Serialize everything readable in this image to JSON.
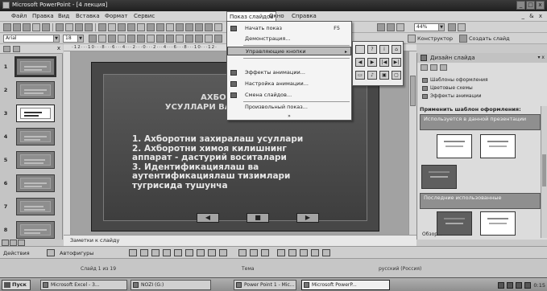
{
  "window": {
    "title": "Microsoft PowerPoint - [4 лекция]",
    "controls": [
      "_",
      "□",
      "x"
    ]
  },
  "menubar": {
    "items": [
      "Файл",
      "Правка",
      "Вид",
      "Вставка",
      "Формат",
      "Сервис",
      "Показ слайдов",
      "Окно",
      "Справка"
    ],
    "doc_controls": "_ & x"
  },
  "toolbar": {
    "font": "Arial",
    "size": "18",
    "zoom": "44%",
    "constructor": "Конструктор",
    "new_slide": "Создать слайд"
  },
  "menu": {
    "items": [
      {
        "label": "Начать показ",
        "shortcut": "F5"
      },
      {
        "label": "Демонстрация..."
      },
      {
        "label": "Управляющие кнопки",
        "submenu": "▸"
      },
      {
        "label": "Эффекты анимации..."
      },
      {
        "label": "Настройка анимации..."
      },
      {
        "label": "Смена слайдов..."
      },
      {
        "label": "Произвольный показ..."
      }
    ],
    "more": "»"
  },
  "action_buttons": [
    "",
    "?",
    "i",
    "⌂",
    "◀",
    "▶",
    "|◀",
    "▶|",
    "▭",
    "♪",
    "▣",
    "▢"
  ],
  "slides": {
    "numbers": [
      "1",
      "2",
      "3",
      "4",
      "5",
      "6",
      "7",
      "8"
    ]
  },
  "slide": {
    "title_line1": "АХБОРОТНИ ...",
    "title_line2": "УСУЛЛАРИ ВА ... МОДЕЛЛАРИ",
    "bullets": [
      "1. Ахборотни захиралаш усуллари",
      "2. Ахборотни химоя килишнинг",
      "аппарат - дастурий воситалари",
      "3. Идентификациялаш ва",
      "аутентификациялаш тизимлари",
      "тугрисида тушунча"
    ],
    "nav": [
      "◀",
      "■",
      "▶"
    ]
  },
  "taskpane": {
    "title": "Дизайн слайда",
    "controls": "▾ x",
    "links": [
      "Шаблоны оформления",
      "Цветовые схемы",
      "Эффекты анимации"
    ],
    "apply_label": "Применить шаблон оформления:",
    "section_used": "Используется в данной презентации",
    "section_recent": "Последние использованные",
    "browse": "Обзор..."
  },
  "notes": {
    "placeholder": "Заметки к слайду"
  },
  "drawbar": {
    "actions": "Действия",
    "autoshapes": "Автофигуры"
  },
  "status": {
    "slide": "Слайд 1 из 19",
    "design": "Тема",
    "language": "русский (Россия)"
  },
  "taskbar": {
    "start": "Пуск",
    "tasks": [
      "Microsoft Excel - 3...",
      "NOZI (G:)",
      "Power Point 1 - Mic...",
      "Microsoft PowerP..."
    ],
    "clock": "0:15"
  },
  "colors": {
    "menu_bg": "#f4f4f4",
    "slide_bg": "#474747",
    "text_on_slide": "#e8e8e8"
  }
}
